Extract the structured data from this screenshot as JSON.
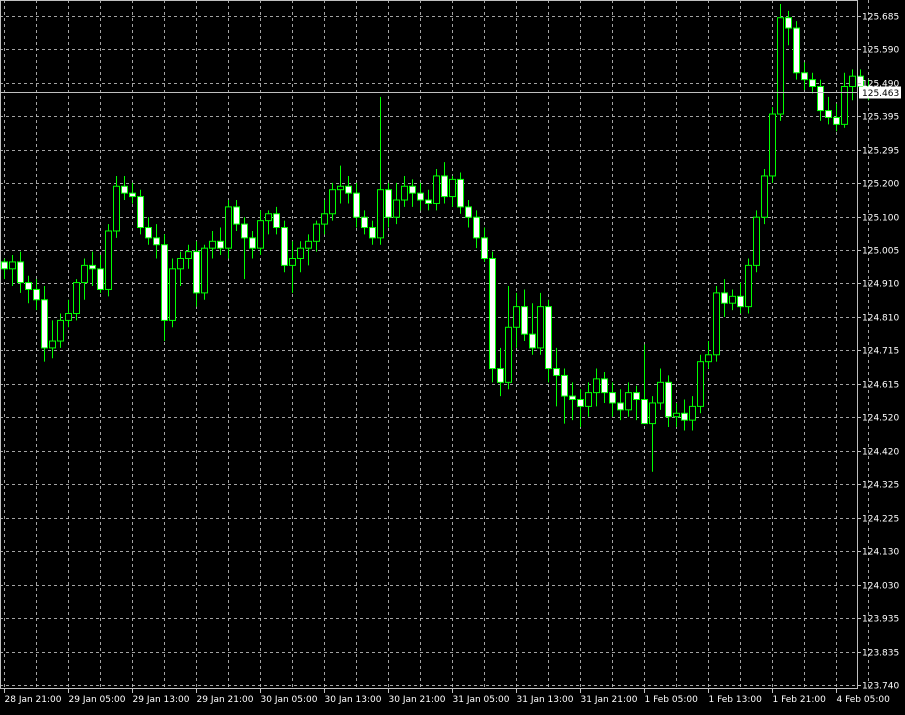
{
  "colors": {
    "background": "#000000",
    "grid": "#c0c0c0",
    "bull_candle": "#000000",
    "bear_candle": "#ffffff",
    "wick": "#00ff00",
    "axis_text": "#ffffff",
    "current_price_line": "#c0c0c0",
    "price_box_bg": "#ffffff"
  },
  "chart_data": {
    "type": "candlestick",
    "grid": true,
    "ylim": [
      123.74,
      125.685
    ],
    "yticks": [
      "125.685",
      "125.590",
      "125.490",
      "125.395",
      "125.295",
      "125.200",
      "125.100",
      "125.005",
      "124.910",
      "124.810",
      "124.715",
      "124.615",
      "124.520",
      "124.420",
      "124.325",
      "124.225",
      "124.130",
      "124.030",
      "123.935",
      "123.835",
      "123.740"
    ],
    "xticks": [
      "28 Jan 21:00",
      "29 Jan 05:00",
      "29 Jan 13:00",
      "29 Jan 21:00",
      "30 Jan 05:00",
      "30 Jan 13:00",
      "30 Jan 21:00",
      "31 Jan 05:00",
      "31 Jan 13:00",
      "31 Jan 21:00",
      "1 Feb 05:00",
      "1 Feb 13:00",
      "1 Feb 21:00",
      "4 Feb 05:00"
    ],
    "current_price": "125.463",
    "candles": [
      [
        124.97,
        124.98,
        124.92,
        124.95
      ],
      [
        124.95,
        124.99,
        124.9,
        124.97
      ],
      [
        124.97,
        125.0,
        124.88,
        124.91
      ],
      [
        124.91,
        124.93,
        124.85,
        124.89
      ],
      [
        124.89,
        124.92,
        124.83,
        124.86
      ],
      [
        124.86,
        124.9,
        124.68,
        124.72
      ],
      [
        124.72,
        124.8,
        124.69,
        124.74
      ],
      [
        124.74,
        124.82,
        124.72,
        124.8
      ],
      [
        124.8,
        124.86,
        124.78,
        124.82
      ],
      [
        124.82,
        124.92,
        124.8,
        124.91
      ],
      [
        124.91,
        124.98,
        124.86,
        124.96
      ],
      [
        124.96,
        125.0,
        124.9,
        124.95
      ],
      [
        124.95,
        124.99,
        124.88,
        124.89
      ],
      [
        124.89,
        125.08,
        124.87,
        125.06
      ],
      [
        125.06,
        125.22,
        125.04,
        125.19
      ],
      [
        125.19,
        125.22,
        125.15,
        125.17
      ],
      [
        125.17,
        125.2,
        125.14,
        125.16
      ],
      [
        125.16,
        125.18,
        125.05,
        125.07
      ],
      [
        125.07,
        125.1,
        125.02,
        125.04
      ],
      [
        125.04,
        125.08,
        124.98,
        125.02
      ],
      [
        125.02,
        125.05,
        124.74,
        124.8
      ],
      [
        124.8,
        124.98,
        124.78,
        124.95
      ],
      [
        124.95,
        125.0,
        124.9,
        124.98
      ],
      [
        124.98,
        125.02,
        124.95,
        125.0
      ],
      [
        125.0,
        125.03,
        124.84,
        124.88
      ],
      [
        124.88,
        125.02,
        124.86,
        125.01
      ],
      [
        125.01,
        125.06,
        124.98,
        125.03
      ],
      [
        125.03,
        125.07,
        124.99,
        125.01
      ],
      [
        125.01,
        125.15,
        124.98,
        125.13
      ],
      [
        125.13,
        125.15,
        125.06,
        125.08
      ],
      [
        125.08,
        125.1,
        124.92,
        125.04
      ],
      [
        125.04,
        125.06,
        124.98,
        125.01
      ],
      [
        125.01,
        125.12,
        124.99,
        125.09
      ],
      [
        125.09,
        125.12,
        125.05,
        125.11
      ],
      [
        125.11,
        125.13,
        125.05,
        125.07
      ],
      [
        125.07,
        125.09,
        124.94,
        124.96
      ],
      [
        124.96,
        125.03,
        124.88,
        124.98
      ],
      [
        124.98,
        125.03,
        124.94,
        125.01
      ],
      [
        125.01,
        125.05,
        124.96,
        125.03
      ],
      [
        125.03,
        125.09,
        125.0,
        125.08
      ],
      [
        125.08,
        125.15,
        125.05,
        125.11
      ],
      [
        125.11,
        125.2,
        125.09,
        125.18
      ],
      [
        125.18,
        125.25,
        125.14,
        125.19
      ],
      [
        125.19,
        125.22,
        125.14,
        125.17
      ],
      [
        125.17,
        125.2,
        125.07,
        125.1
      ],
      [
        125.1,
        125.12,
        125.05,
        125.07
      ],
      [
        125.07,
        125.09,
        125.02,
        125.04
      ],
      [
        125.04,
        125.45,
        125.02,
        125.18
      ],
      [
        125.18,
        125.2,
        125.07,
        125.1
      ],
      [
        125.1,
        125.2,
        125.08,
        125.15
      ],
      [
        125.15,
        125.22,
        125.13,
        125.19
      ],
      [
        125.19,
        125.21,
        125.13,
        125.17
      ],
      [
        125.17,
        125.2,
        125.12,
        125.15
      ],
      [
        125.15,
        125.18,
        125.12,
        125.14
      ],
      [
        125.14,
        125.24,
        125.12,
        125.22
      ],
      [
        125.22,
        125.26,
        125.14,
        125.16
      ],
      [
        125.16,
        125.22,
        125.13,
        125.21
      ],
      [
        125.21,
        125.23,
        125.11,
        125.13
      ],
      [
        125.13,
        125.15,
        125.07,
        125.1
      ],
      [
        125.1,
        125.12,
        125.01,
        125.04
      ],
      [
        125.04,
        125.07,
        124.97,
        124.98
      ],
      [
        124.98,
        125.0,
        124.62,
        124.66
      ],
      [
        124.66,
        124.72,
        124.58,
        124.62
      ],
      [
        124.62,
        124.9,
        124.6,
        124.78
      ],
      [
        124.78,
        124.88,
        124.72,
        124.84
      ],
      [
        124.84,
        124.89,
        124.74,
        124.76
      ],
      [
        124.76,
        124.85,
        124.7,
        124.72
      ],
      [
        124.72,
        124.88,
        124.7,
        124.84
      ],
      [
        124.84,
        124.86,
        124.62,
        124.66
      ],
      [
        124.66,
        124.72,
        124.55,
        124.64
      ],
      [
        124.64,
        124.66,
        124.5,
        124.58
      ],
      [
        124.58,
        124.62,
        124.51,
        124.57
      ],
      [
        124.57,
        124.6,
        124.49,
        124.55
      ],
      [
        124.55,
        124.62,
        124.52,
        124.59
      ],
      [
        124.59,
        124.66,
        124.55,
        124.63
      ],
      [
        124.63,
        124.65,
        124.56,
        124.59
      ],
      [
        124.59,
        124.62,
        124.52,
        124.56
      ],
      [
        124.56,
        124.6,
        124.51,
        124.54
      ],
      [
        124.54,
        124.62,
        124.52,
        124.59
      ],
      [
        124.59,
        124.61,
        124.51,
        124.57
      ],
      [
        124.57,
        124.73,
        124.52,
        124.5
      ],
      [
        124.5,
        124.58,
        124.36,
        124.56
      ],
      [
        124.56,
        124.66,
        124.54,
        124.62
      ],
      [
        124.62,
        124.64,
        124.49,
        124.52
      ],
      [
        124.52,
        124.56,
        124.49,
        124.53
      ],
      [
        124.53,
        124.57,
        124.48,
        124.51
      ],
      [
        124.51,
        124.58,
        124.48,
        124.55
      ],
      [
        124.55,
        124.7,
        124.53,
        124.68
      ],
      [
        124.68,
        124.74,
        124.66,
        124.7
      ],
      [
        124.7,
        124.9,
        124.68,
        124.88
      ],
      [
        124.88,
        124.92,
        124.81,
        124.85
      ],
      [
        124.85,
        124.89,
        124.83,
        124.87
      ],
      [
        124.87,
        124.91,
        124.82,
        124.84
      ],
      [
        124.84,
        124.98,
        124.82,
        124.96
      ],
      [
        124.96,
        125.12,
        124.94,
        125.1
      ],
      [
        125.1,
        125.24,
        125.08,
        125.22
      ],
      [
        125.22,
        125.42,
        125.2,
        125.4
      ],
      [
        125.4,
        125.72,
        125.38,
        125.68
      ],
      [
        125.68,
        125.7,
        125.6,
        125.65
      ],
      [
        125.65,
        125.67,
        125.5,
        125.52
      ],
      [
        125.52,
        125.55,
        125.47,
        125.5
      ],
      [
        125.5,
        125.52,
        125.46,
        125.48
      ],
      [
        125.48,
        125.5,
        125.38,
        125.41
      ],
      [
        125.41,
        125.45,
        125.37,
        125.39
      ],
      [
        125.39,
        125.43,
        125.35,
        125.37
      ],
      [
        125.37,
        125.52,
        125.36,
        125.48
      ],
      [
        125.48,
        125.53,
        125.44,
        125.51
      ],
      [
        125.51,
        125.53,
        125.46,
        125.48
      ],
      [
        125.48,
        125.5,
        125.44,
        125.46
      ]
    ]
  }
}
